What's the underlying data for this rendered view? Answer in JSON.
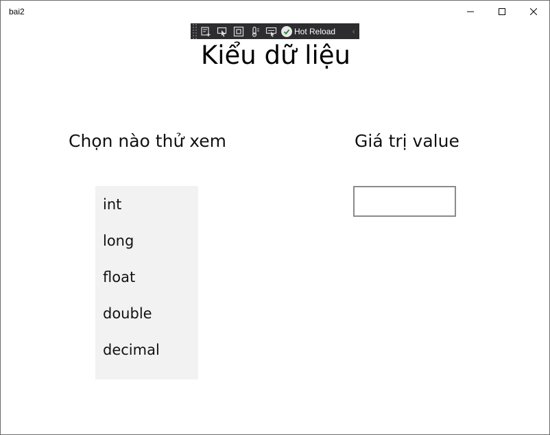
{
  "window": {
    "title": "bai2",
    "controls": [
      "minimize-icon",
      "maximize-icon",
      "close-icon"
    ]
  },
  "devbar": {
    "hot_reload_label": "Hot Reload",
    "icons": [
      "live-visual-tree-icon",
      "select-element-icon",
      "display-layout-adorners-icon",
      "track-focus-icon",
      "preview-selection-icon",
      "hot-reload-check-icon",
      "collapse-chevron-icon"
    ]
  },
  "main": {
    "title": "Kiểu dữ liệu",
    "left_heading": "Chọn nào thử xem",
    "right_heading": "Giá trị value",
    "list_items": [
      "int",
      "long",
      "float",
      "double",
      "decimal"
    ],
    "value_input": ""
  }
}
